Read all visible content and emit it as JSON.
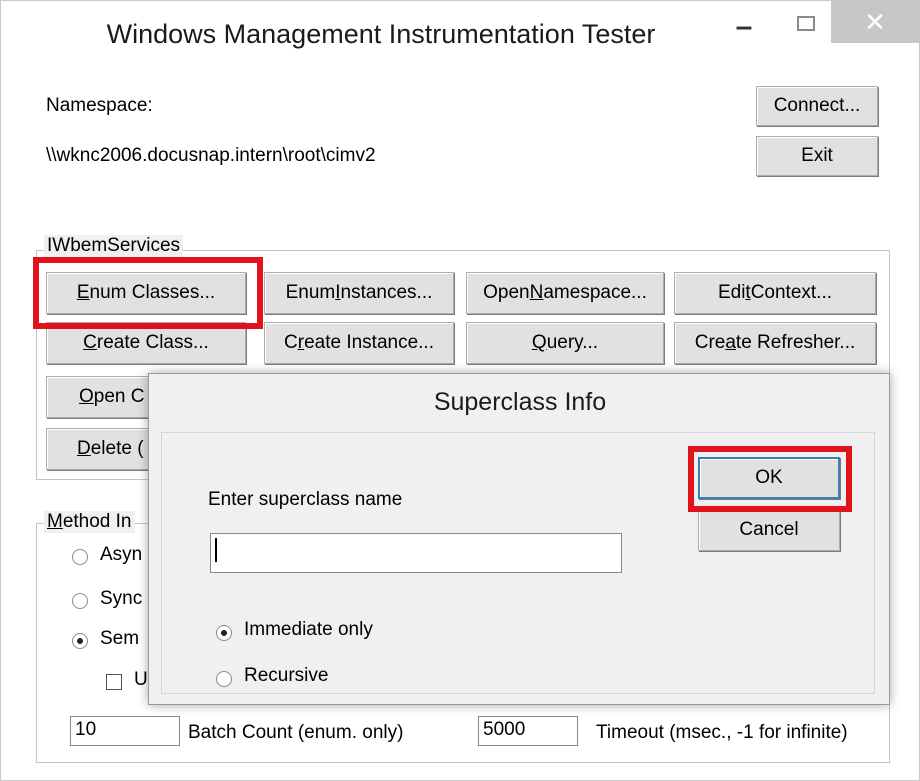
{
  "window": {
    "title": "Windows Management Instrumentation Tester",
    "minimize_glyph": "–",
    "close_glyph": "✕"
  },
  "namespace": {
    "label": "Namespace:",
    "value": "\\\\wknc2006.docusnap.intern\\root\\cimv2"
  },
  "top_buttons": {
    "connect": "Connect...",
    "exit": "Exit"
  },
  "services_group": {
    "label": "IWbemServices",
    "enum_classes": {
      "pre": "",
      "ul": "E",
      "post": "num Classes..."
    },
    "enum_instances": {
      "pre": "Enum ",
      "ul": "I",
      "post": "nstances..."
    },
    "open_namespace": {
      "pre": "Open ",
      "ul": "N",
      "post": "amespace..."
    },
    "edit_context": {
      "pre": "Edi",
      "ul": "t",
      "post": " Context..."
    },
    "create_class": {
      "pre": "",
      "ul": "C",
      "post": "reate Class..."
    },
    "create_instance": {
      "pre": "C",
      "ul": "r",
      "post": "eate Instance..."
    },
    "query": {
      "pre": "",
      "ul": "Q",
      "post": "uery..."
    },
    "create_refresher": {
      "pre": "Cre",
      "ul": "a",
      "post": "te Refresher..."
    },
    "open_class_partial": {
      "pre": "",
      "ul": "O",
      "post": "pen C"
    },
    "delete_class_partial": {
      "pre": "",
      "ul": "D",
      "post": "elete ("
    }
  },
  "method_group": {
    "label_pre": "",
    "label_ul": "M",
    "label_post": "ethod In",
    "options": [
      "Asyn",
      "Sync",
      "Sem"
    ],
    "selected_index": 2,
    "checkbox_label": "U",
    "batch_count_value": "10",
    "batch_count_label": "Batch Count (enum. only)",
    "timeout_value": "5000",
    "timeout_label": "Timeout (msec., -1 for infinite)"
  },
  "dialog": {
    "title": "Superclass Info",
    "prompt": "Enter superclass name",
    "input_value": "",
    "ok": "OK",
    "cancel": "Cancel",
    "options": [
      "Immediate only",
      "Recursive"
    ],
    "selected_index": 0
  },
  "highlight_color": "#e0121b"
}
